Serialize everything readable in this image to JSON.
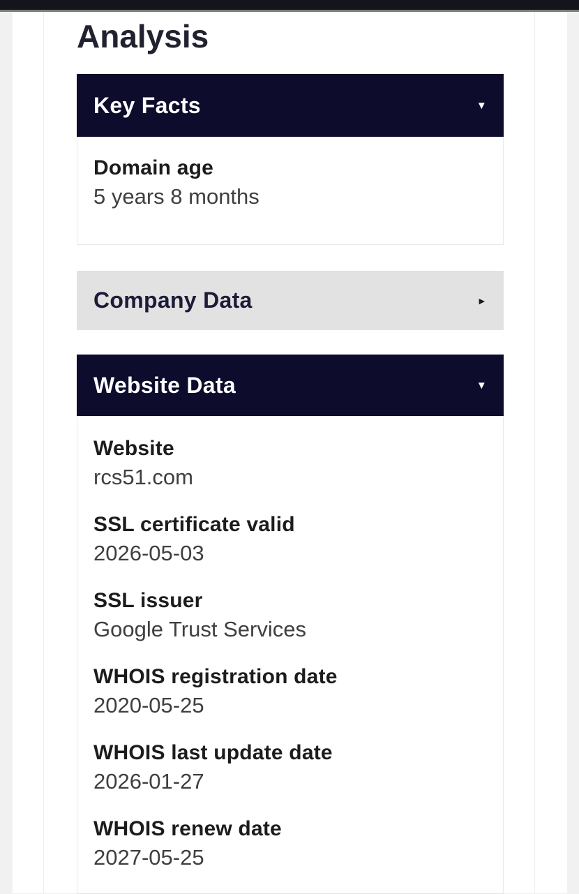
{
  "page": {
    "title": "Analysis"
  },
  "icons": {
    "expanded": "▼",
    "collapsed": "►"
  },
  "colors": {
    "header_navy": "#0d0c2c",
    "header_gray": "#e2e2e2",
    "header_text_light": "#ffffff",
    "heading_text": "#20222f",
    "top_bar": "#14141d"
  },
  "sections": [
    {
      "label": "Key Facts",
      "state": "expanded",
      "items": [
        {
          "label": "Domain age",
          "value": "5 years 8 months"
        }
      ]
    },
    {
      "label": "Company Data",
      "state": "collapsed",
      "items": []
    },
    {
      "label": "Website Data",
      "state": "expanded",
      "items": [
        {
          "label": "Website",
          "value": "rcs51.com"
        },
        {
          "label": "SSL certificate valid",
          "value": "2026-05-03"
        },
        {
          "label": "SSL issuer",
          "value": "Google Trust Services"
        },
        {
          "label": "WHOIS registration date",
          "value": "2020-05-25"
        },
        {
          "label": "WHOIS last update date",
          "value": "2026-01-27"
        },
        {
          "label": "WHOIS renew date",
          "value": "2027-05-25"
        }
      ]
    }
  ]
}
